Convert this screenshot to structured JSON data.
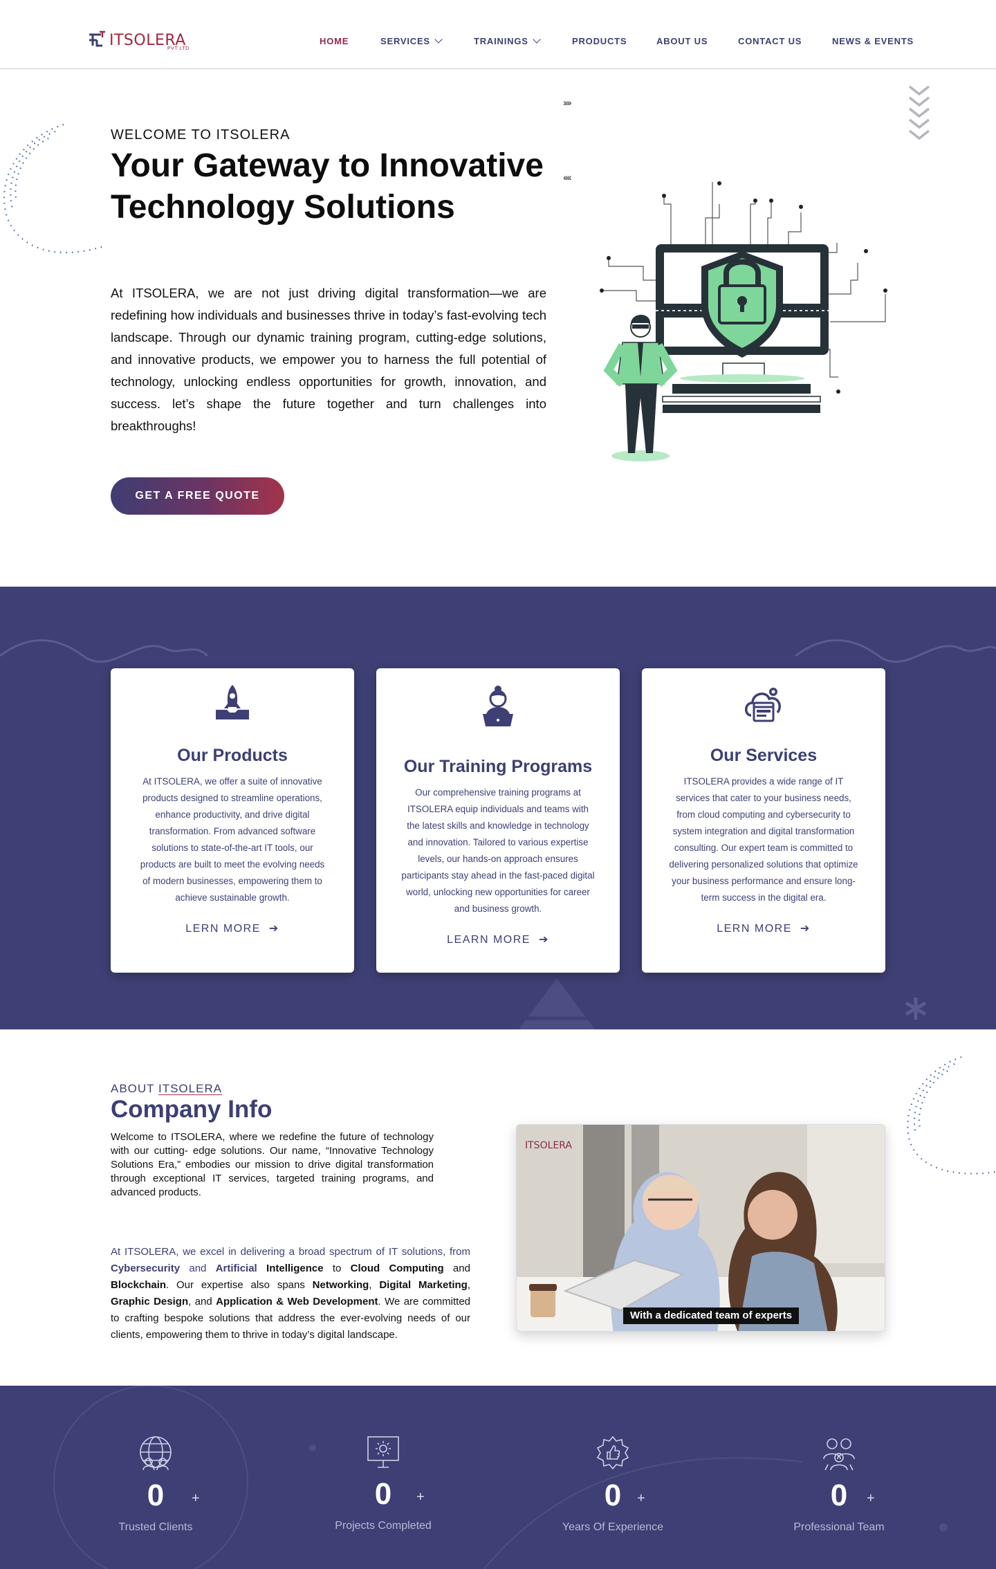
{
  "brand": {
    "name": "ITSOLERA",
    "tagline": "PVT LTD",
    "accent": "#a3273e",
    "primary": "#3e3f74"
  },
  "nav": {
    "items": [
      {
        "label": "HOME",
        "active": true
      },
      {
        "label": "SERVICES",
        "dropdown": true
      },
      {
        "label": "TRAININGS",
        "dropdown": true
      },
      {
        "label": "PRODUCTS"
      },
      {
        "label": "ABOUT US"
      },
      {
        "label": "CONTACT US"
      },
      {
        "label": "NEWS & EVENTS"
      }
    ]
  },
  "hero": {
    "welcome": "WELCOME TO ITSOLERA",
    "title": "Your Gateway to Innovative Technology Solutions",
    "text": "At ITSOLERA, we are not just driving digital transformation—we are redefining how individuals and businesses thrive in today’s fast-evolving tech landscape. Through our dynamic training program, cutting-edge solutions, and innovative products, we empower you to harness the full potential of technology, unlocking  endless opportunities for growth, innovation, and success. let’s shape the future together and turn challenges into breakthroughs!",
    "cta": "GET A FREE QUOTE",
    "arrows_right": "››››",
    "arrows_left": "‹‹‹‹"
  },
  "cards": [
    {
      "icon": "rocket-laptop-icon",
      "title": "Our Products",
      "text": "At ITSOLERA, we offer a suite of innovative products designed to streamline operations, enhance productivity, and drive digital transformation. From advanced software solutions to state-of-the-art IT tools, our products are built to meet the evolving needs of modern businesses, empowering them to achieve sustainable growth.",
      "link": "LERN MORE"
    },
    {
      "icon": "trainer-laptop-icon",
      "title": "Our Training Programs",
      "text": "Our comprehensive training programs at ITSOLERA equip individuals and teams with the latest skills and knowledge in technology and innovation. Tailored to various expertise levels, our hands-on approach ensures participants stay ahead in the fast-paced digital world, unlocking new opportunities for career and business growth.",
      "link": "LEARN MORE"
    },
    {
      "icon": "cloud-settings-icon",
      "title": "Our Services",
      "text": "ITSOLERA provides a wide range of IT services that cater to your business needs, from cloud computing and cybersecurity to system integration and digital transformation consulting. Our expert team is committed to delivering personalized solutions that optimize your business performance and ensure long-term success in the digital era.",
      "link": "LERN MORE"
    }
  ],
  "about": {
    "kicker_prefix": "ABOUT ",
    "kicker_brand": "ITSOLERA",
    "title": "Company Info",
    "p1": "Welcome to ITSOLERA, where we redefine the future of technology with our cutting- edge solutions. Our name, “Innovative Technology Solutions Era,” embodies our mission to drive digital transformation through exceptional IT services, targeted training programs, and advanced products.",
    "p2": {
      "a": "At ITSOLERA, we excel in delivering a broad spectrum of IT solutions, from ",
      "b": "Cybersecurity",
      "c": " and ",
      "d": "Artificial",
      "e": " Intelligence",
      "f": " to ",
      "g": "Cloud Computing",
      "h": " and ",
      "i": "Blockchain",
      "j": ". Our expertise also spans ",
      "k": "Networking",
      "l": ", ",
      "m": "Digital Marketing",
      "n": ", ",
      "o": "Graphic Design",
      "p": ", and ",
      "q": "Application & Web Development",
      "r": ". We are committed to crafting bespoke solutions that address the ever-evolving needs of our clients, empowering them to thrive in today’s digital landscape."
    },
    "image_caption": "With a dedicated team of experts",
    "image_logo": "ITSOLERA"
  },
  "stats": [
    {
      "icon": "globe-people-icon",
      "value": "0",
      "suffix": "+",
      "label": "Trusted Clients"
    },
    {
      "icon": "presentation-board-icon",
      "value": "0",
      "suffix": "+",
      "label": "Projects Completed"
    },
    {
      "icon": "award-thumbs-up-icon",
      "value": "0",
      "suffix": "+",
      "label": "Years Of Experience"
    },
    {
      "icon": "team-members-icon",
      "value": "0",
      "suffix": "+",
      "label": "Professional Team"
    }
  ]
}
